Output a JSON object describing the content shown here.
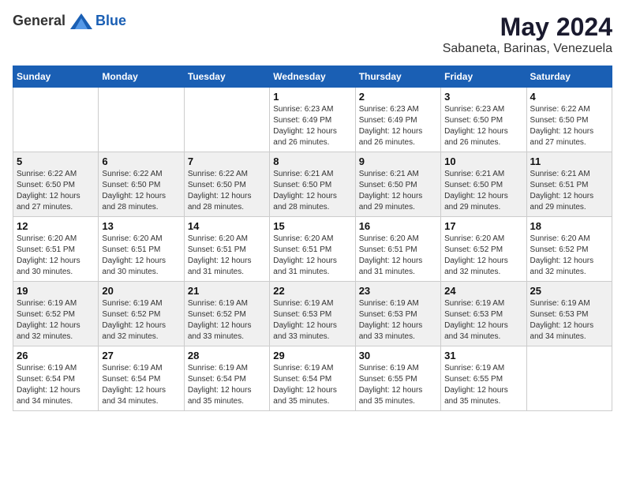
{
  "logo": {
    "text_general": "General",
    "text_blue": "Blue"
  },
  "title": {
    "month_year": "May 2024",
    "location": "Sabaneta, Barinas, Venezuela"
  },
  "weekdays": [
    "Sunday",
    "Monday",
    "Tuesday",
    "Wednesday",
    "Thursday",
    "Friday",
    "Saturday"
  ],
  "weeks": [
    [
      {
        "day": "",
        "sunrise": "",
        "sunset": "",
        "daylight": ""
      },
      {
        "day": "",
        "sunrise": "",
        "sunset": "",
        "daylight": ""
      },
      {
        "day": "",
        "sunrise": "",
        "sunset": "",
        "daylight": ""
      },
      {
        "day": "1",
        "sunrise": "Sunrise: 6:23 AM",
        "sunset": "Sunset: 6:49 PM",
        "daylight": "Daylight: 12 hours and 26 minutes."
      },
      {
        "day": "2",
        "sunrise": "Sunrise: 6:23 AM",
        "sunset": "Sunset: 6:49 PM",
        "daylight": "Daylight: 12 hours and 26 minutes."
      },
      {
        "day": "3",
        "sunrise": "Sunrise: 6:23 AM",
        "sunset": "Sunset: 6:50 PM",
        "daylight": "Daylight: 12 hours and 26 minutes."
      },
      {
        "day": "4",
        "sunrise": "Sunrise: 6:22 AM",
        "sunset": "Sunset: 6:50 PM",
        "daylight": "Daylight: 12 hours and 27 minutes."
      }
    ],
    [
      {
        "day": "5",
        "sunrise": "Sunrise: 6:22 AM",
        "sunset": "Sunset: 6:50 PM",
        "daylight": "Daylight: 12 hours and 27 minutes."
      },
      {
        "day": "6",
        "sunrise": "Sunrise: 6:22 AM",
        "sunset": "Sunset: 6:50 PM",
        "daylight": "Daylight: 12 hours and 28 minutes."
      },
      {
        "day": "7",
        "sunrise": "Sunrise: 6:22 AM",
        "sunset": "Sunset: 6:50 PM",
        "daylight": "Daylight: 12 hours and 28 minutes."
      },
      {
        "day": "8",
        "sunrise": "Sunrise: 6:21 AM",
        "sunset": "Sunset: 6:50 PM",
        "daylight": "Daylight: 12 hours and 28 minutes."
      },
      {
        "day": "9",
        "sunrise": "Sunrise: 6:21 AM",
        "sunset": "Sunset: 6:50 PM",
        "daylight": "Daylight: 12 hours and 29 minutes."
      },
      {
        "day": "10",
        "sunrise": "Sunrise: 6:21 AM",
        "sunset": "Sunset: 6:50 PM",
        "daylight": "Daylight: 12 hours and 29 minutes."
      },
      {
        "day": "11",
        "sunrise": "Sunrise: 6:21 AM",
        "sunset": "Sunset: 6:51 PM",
        "daylight": "Daylight: 12 hours and 29 minutes."
      }
    ],
    [
      {
        "day": "12",
        "sunrise": "Sunrise: 6:20 AM",
        "sunset": "Sunset: 6:51 PM",
        "daylight": "Daylight: 12 hours and 30 minutes."
      },
      {
        "day": "13",
        "sunrise": "Sunrise: 6:20 AM",
        "sunset": "Sunset: 6:51 PM",
        "daylight": "Daylight: 12 hours and 30 minutes."
      },
      {
        "day": "14",
        "sunrise": "Sunrise: 6:20 AM",
        "sunset": "Sunset: 6:51 PM",
        "daylight": "Daylight: 12 hours and 31 minutes."
      },
      {
        "day": "15",
        "sunrise": "Sunrise: 6:20 AM",
        "sunset": "Sunset: 6:51 PM",
        "daylight": "Daylight: 12 hours and 31 minutes."
      },
      {
        "day": "16",
        "sunrise": "Sunrise: 6:20 AM",
        "sunset": "Sunset: 6:51 PM",
        "daylight": "Daylight: 12 hours and 31 minutes."
      },
      {
        "day": "17",
        "sunrise": "Sunrise: 6:20 AM",
        "sunset": "Sunset: 6:52 PM",
        "daylight": "Daylight: 12 hours and 32 minutes."
      },
      {
        "day": "18",
        "sunrise": "Sunrise: 6:20 AM",
        "sunset": "Sunset: 6:52 PM",
        "daylight": "Daylight: 12 hours and 32 minutes."
      }
    ],
    [
      {
        "day": "19",
        "sunrise": "Sunrise: 6:19 AM",
        "sunset": "Sunset: 6:52 PM",
        "daylight": "Daylight: 12 hours and 32 minutes."
      },
      {
        "day": "20",
        "sunrise": "Sunrise: 6:19 AM",
        "sunset": "Sunset: 6:52 PM",
        "daylight": "Daylight: 12 hours and 32 minutes."
      },
      {
        "day": "21",
        "sunrise": "Sunrise: 6:19 AM",
        "sunset": "Sunset: 6:52 PM",
        "daylight": "Daylight: 12 hours and 33 minutes."
      },
      {
        "day": "22",
        "sunrise": "Sunrise: 6:19 AM",
        "sunset": "Sunset: 6:53 PM",
        "daylight": "Daylight: 12 hours and 33 minutes."
      },
      {
        "day": "23",
        "sunrise": "Sunrise: 6:19 AM",
        "sunset": "Sunset: 6:53 PM",
        "daylight": "Daylight: 12 hours and 33 minutes."
      },
      {
        "day": "24",
        "sunrise": "Sunrise: 6:19 AM",
        "sunset": "Sunset: 6:53 PM",
        "daylight": "Daylight: 12 hours and 34 minutes."
      },
      {
        "day": "25",
        "sunrise": "Sunrise: 6:19 AM",
        "sunset": "Sunset: 6:53 PM",
        "daylight": "Daylight: 12 hours and 34 minutes."
      }
    ],
    [
      {
        "day": "26",
        "sunrise": "Sunrise: 6:19 AM",
        "sunset": "Sunset: 6:54 PM",
        "daylight": "Daylight: 12 hours and 34 minutes."
      },
      {
        "day": "27",
        "sunrise": "Sunrise: 6:19 AM",
        "sunset": "Sunset: 6:54 PM",
        "daylight": "Daylight: 12 hours and 34 minutes."
      },
      {
        "day": "28",
        "sunrise": "Sunrise: 6:19 AM",
        "sunset": "Sunset: 6:54 PM",
        "daylight": "Daylight: 12 hours and 35 minutes."
      },
      {
        "day": "29",
        "sunrise": "Sunrise: 6:19 AM",
        "sunset": "Sunset: 6:54 PM",
        "daylight": "Daylight: 12 hours and 35 minutes."
      },
      {
        "day": "30",
        "sunrise": "Sunrise: 6:19 AM",
        "sunset": "Sunset: 6:55 PM",
        "daylight": "Daylight: 12 hours and 35 minutes."
      },
      {
        "day": "31",
        "sunrise": "Sunrise: 6:19 AM",
        "sunset": "Sunset: 6:55 PM",
        "daylight": "Daylight: 12 hours and 35 minutes."
      },
      {
        "day": "",
        "sunrise": "",
        "sunset": "",
        "daylight": ""
      }
    ]
  ]
}
